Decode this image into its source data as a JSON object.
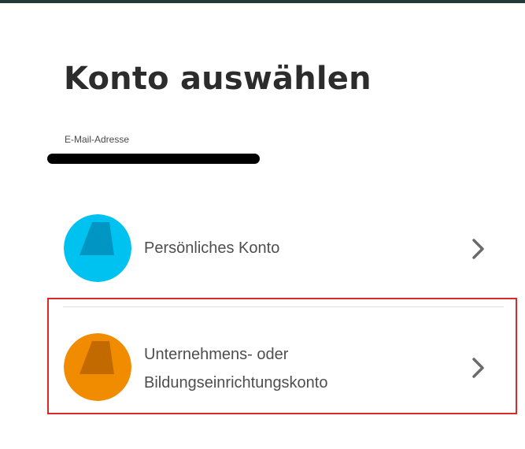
{
  "page": {
    "title": "Konto auswählen",
    "email_label": "E-Mail-Adresse"
  },
  "accounts": [
    {
      "label": "Persönliches Konto",
      "avatar_color": "#00C2F0",
      "avatar_shade": "#0095C2",
      "icon": "chevron-right-icon"
    },
    {
      "label_line1": "Unternehmens- oder",
      "label_line2": "Bildungseinrichtungskonto",
      "avatar_color": "#F18C00",
      "avatar_shade": "#C26A00",
      "icon": "chevron-right-icon"
    }
  ],
  "colors": {
    "title": "#2C2C2C",
    "highlight_border": "#D62B2B",
    "chevron": "#6B6B6B"
  }
}
